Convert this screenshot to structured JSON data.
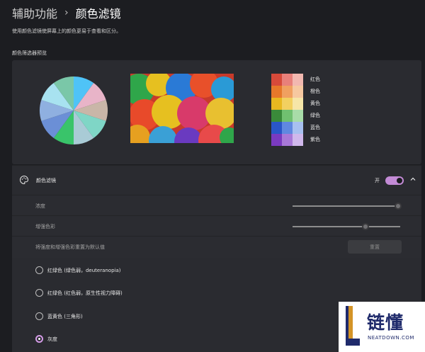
{
  "breadcrumb": {
    "parent": "辅助功能",
    "separator": "›",
    "current": "颜色滤镜"
  },
  "description": "使用颜色滤镜使屏幕上的颜色更易于查看和区分。",
  "preview": {
    "title": "颜色筛选器预览",
    "pie_colors": [
      "#4fc3f7",
      "#e8b4c8",
      "#c9b6a8",
      "#7fd6c6",
      "#a9cbd6",
      "#39c46a",
      "#6b8fd6",
      "#8fb0e0",
      "#a8e2f0",
      "#7ac7a8"
    ],
    "swatch_rows": [
      {
        "label": "红色",
        "colors": [
          "#d64a3a",
          "#e8807a",
          "#f2b8b0"
        ]
      },
      {
        "label": "橙色",
        "colors": [
          "#e6782a",
          "#f0a060",
          "#f6c8a0"
        ]
      },
      {
        "label": "黄色",
        "colors": [
          "#e8b820",
          "#f2d060",
          "#f6e6a8"
        ]
      },
      {
        "label": "绿色",
        "colors": [
          "#3a8a3a",
          "#70c070",
          "#a8dca8"
        ]
      },
      {
        "label": "蓝色",
        "colors": [
          "#2a56c8",
          "#6088e0",
          "#a8c0f0"
        ]
      },
      {
        "label": "紫色",
        "colors": [
          "#7a3ac0",
          "#a878d8",
          "#d0b8ec"
        ]
      }
    ]
  },
  "filter": {
    "label": "颜色滤镜",
    "state": "开",
    "enabled": true
  },
  "intensity": {
    "label": "浓度",
    "value": 0.98
  },
  "boost": {
    "label": "增强色彩",
    "value": 0.68
  },
  "reset": {
    "label": "将强度和增强色彩重置为默认值",
    "button": "重置"
  },
  "options": [
    {
      "label": "红绿色 (绿色弱，deuteranopia)",
      "selected": false
    },
    {
      "label": "红绿色 (红色弱，原生性视力障碍)",
      "selected": false
    },
    {
      "label": "蓝黄色 (三角形)",
      "selected": false
    },
    {
      "label": "灰度",
      "selected": true
    }
  ],
  "watermark": {
    "brand": "链懂",
    "site": "NEATDOWN.COM"
  }
}
